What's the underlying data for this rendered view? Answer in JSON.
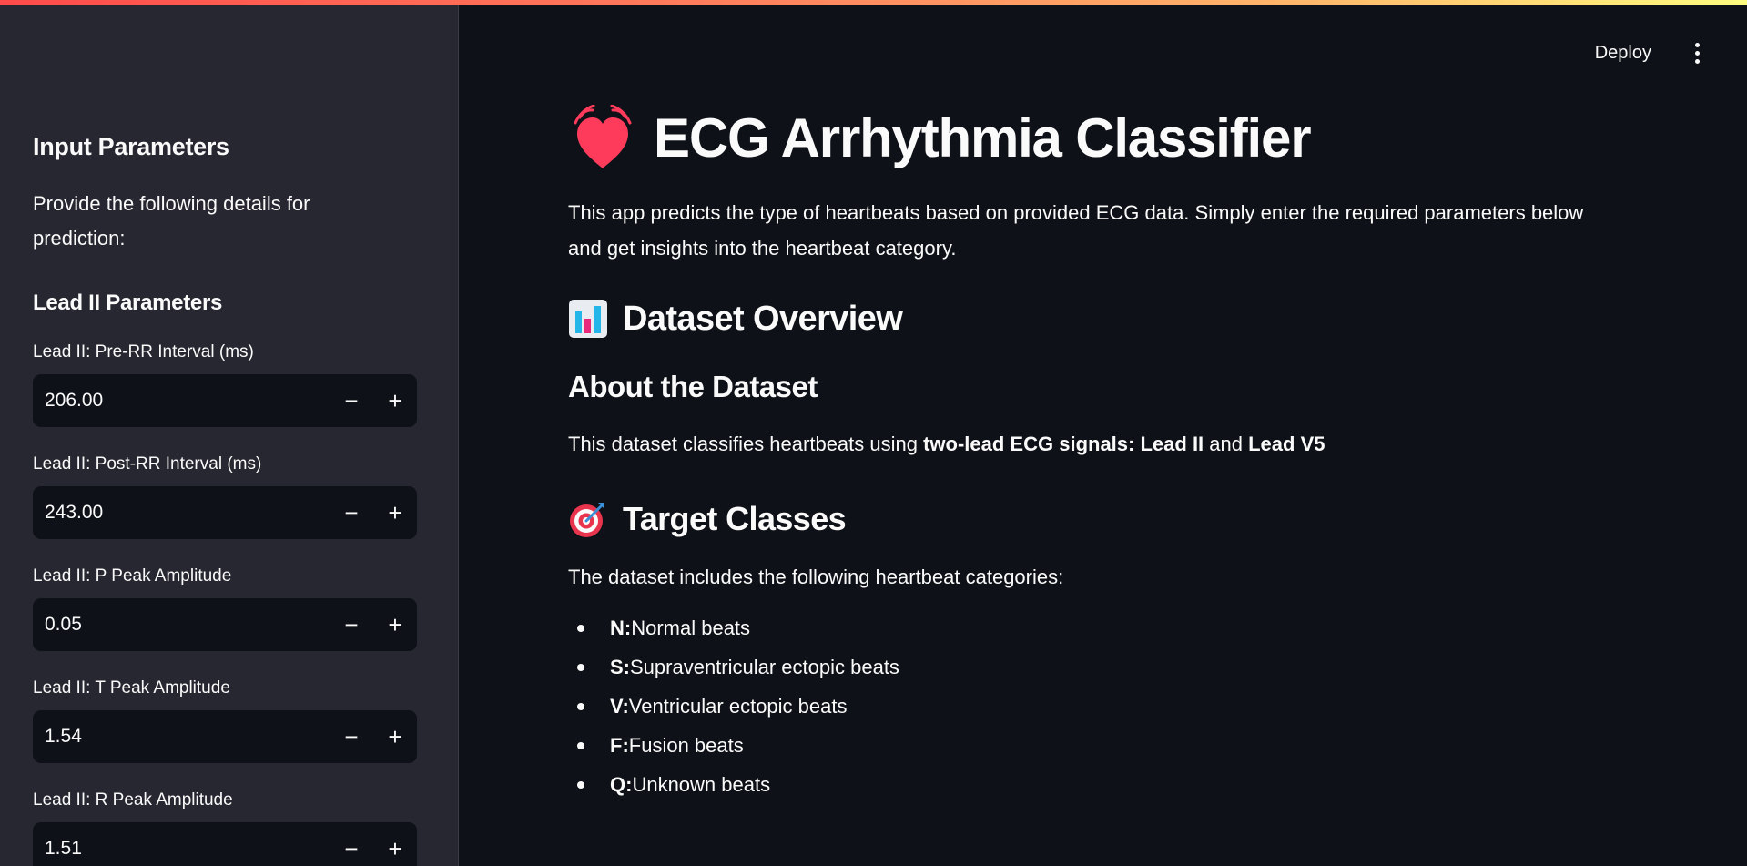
{
  "sidebar": {
    "header": "Input Parameters",
    "description": "Provide the following details for prediction:",
    "subheader": "Lead II Parameters",
    "fields": [
      {
        "label": "Lead II: Pre-RR Interval (ms)",
        "value": "206.00"
      },
      {
        "label": "Lead II: Post-RR Interval (ms)",
        "value": "243.00"
      },
      {
        "label": "Lead II: P Peak Amplitude",
        "value": "0.05"
      },
      {
        "label": "Lead II: T Peak Amplitude",
        "value": "1.54"
      },
      {
        "label": "Lead II: R Peak Amplitude",
        "value": "1.51"
      }
    ],
    "minus_symbol": "−",
    "plus_symbol": "+"
  },
  "header": {
    "deploy_label": "Deploy"
  },
  "main": {
    "title": "ECG Arrhythmia Classifier",
    "intro": "This app predicts the type of heartbeats based on provided ECG data. Simply enter the required parameters below and get insights into the heartbeat category.",
    "dataset_overview_heading": "Dataset Overview",
    "about_heading": "About the Dataset",
    "about_text_prefix": "This dataset classifies heartbeats using ",
    "about_text_bold1": "two-lead ECG signals",
    "about_text_colon": ": ",
    "about_text_bold2": "Lead II",
    "about_text_and": " and ",
    "about_text_bold3": "Lead V5",
    "target_heading": "Target Classes",
    "target_intro": "The dataset includes the following heartbeat categories:",
    "classes": [
      {
        "code": "N:",
        "desc": " Normal beats"
      },
      {
        "code": "S:",
        "desc": " Supraventricular ectopic beats"
      },
      {
        "code": "V:",
        "desc": " Ventricular ectopic beats"
      },
      {
        "code": "F:",
        "desc": " Fusion beats"
      },
      {
        "code": "Q:",
        "desc": " Unknown beats"
      }
    ]
  },
  "icons": {
    "title_icon": "beating-heart-icon",
    "overview_icon": "bar-chart-icon",
    "target_icon": "target-dart-icon",
    "menu_icon": "kebab-menu-icon"
  },
  "colors": {
    "background": "#0e1117",
    "sidebar": "#262730",
    "heart": "#ff3b5c",
    "text": "#fafafa"
  }
}
